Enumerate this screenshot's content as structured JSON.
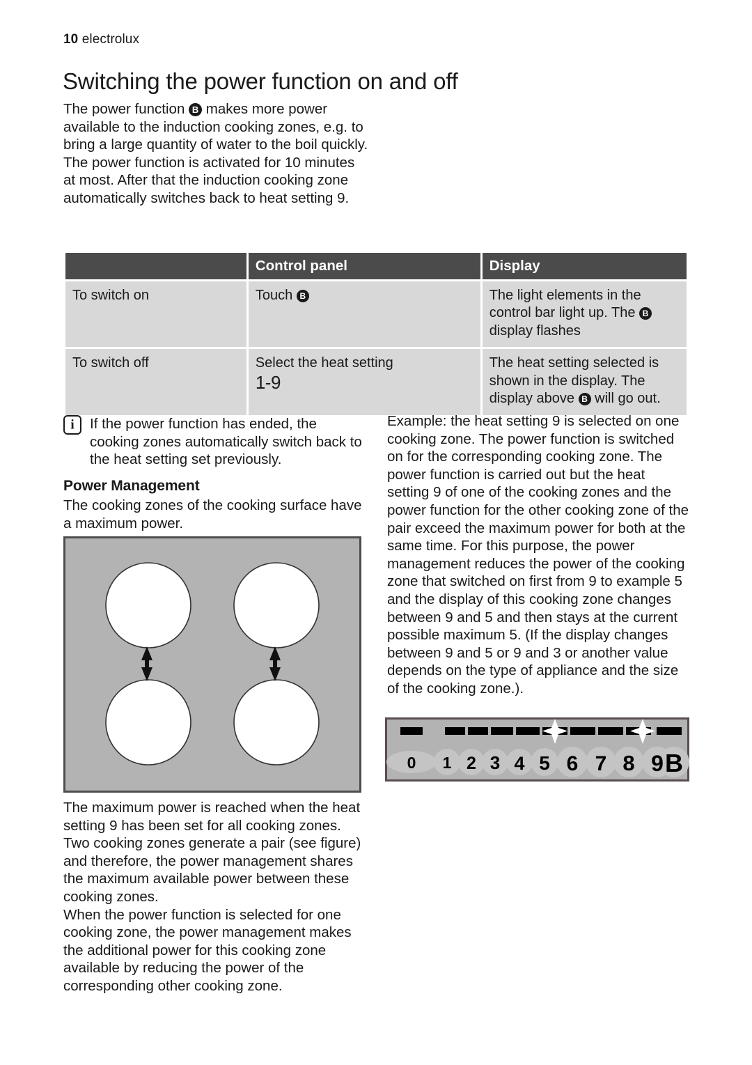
{
  "header": {
    "page_number": "10",
    "brand": "electrolux"
  },
  "title": "Switching the power function on and off",
  "intro": {
    "p1_before_badge": "The power function ",
    "badge": "B",
    "p1_after_badge": " makes more power available to the induction cooking zones, e.g. to bring a large quantity of water to the boil quickly.",
    "p2": "The power function is activated for 10 minutes at most. After that the induction cooking zone automatically switches back to heat setting 9."
  },
  "table": {
    "headers": {
      "blank": "",
      "control_panel": "Control panel",
      "display": "Display"
    },
    "rows": [
      {
        "action": "To switch on",
        "control_panel_text": "Touch ",
        "control_panel_badge": "B",
        "control_panel_range": "",
        "display_part1": "The light elements in the control bar light up. The ",
        "display_badge": "B",
        "display_part2": " display flashes"
      },
      {
        "action": "To switch off",
        "control_panel_text": "Select the heat setting",
        "control_panel_badge": "",
        "control_panel_range": "1-9",
        "display_part1": "The heat setting selected is shown in the display. The display above ",
        "display_badge": "B",
        "display_part2": " will go out."
      }
    ]
  },
  "note": {
    "icon": "info-icon",
    "icon_glyph": "i",
    "text": "If the power function has ended, the cooking zones automatically switch back to the heat setting set previously."
  },
  "power_management": {
    "heading": "Power Management",
    "intro": "The cooking zones of the cooking surface have a maximum power.",
    "after_figure": "The maximum power is reached when the heat setting 9 has been set for all cooking zones.\nTwo cooking zones generate a pair (see figure) and therefore, the power management shares the maximum available power between these cooking zones.\nWhen the power function is selected for one cooking zone, the power management makes the additional power for this cooking zone available by reducing the power of the corresponding other cooking zone."
  },
  "example": {
    "text": "Example: the heat setting 9 is selected on one cooking zone. The power function is switched on for the corresponding cooking zone. The power function is carried out but the heat setting 9 of one of the cooking zones and the power function for the other cooking zone of the pair exceed the maximum power for both at the same time. For this purpose, the power management reduces the power of the cooking zone that switched on first from 9 to example 5 and the display of this cooking zone changes between 9 and 5 and then stays at the current possible maximum 5. (If the display changes between 9 and 5 or 9 and 3 or another value depends on the type of appliance and the size of the cooking zone.)."
  },
  "hob_figure": {
    "name": "cooking-surface-diagram",
    "surface_color": "#b3b3b3",
    "zone_color": "#ffffff",
    "zone_count": 4,
    "pair_arrows": 2
  },
  "control_bar_figure": {
    "name": "control-bar-diagram",
    "background_color": "#b3b3b3",
    "segment_color": "#000000",
    "labels": [
      "0",
      "1",
      "2",
      "3",
      "4",
      "5",
      "6",
      "7",
      "8",
      "9",
      "B"
    ],
    "flash_positions": [
      "5",
      "9"
    ],
    "zero_is_wide": true
  }
}
